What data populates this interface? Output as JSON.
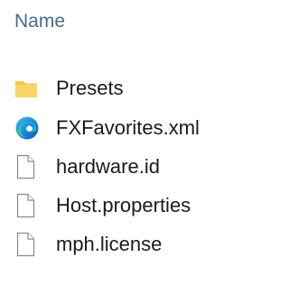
{
  "file_list": {
    "column_header": "Name",
    "items": [
      {
        "label": "Presets",
        "icon": "folder-icon",
        "color": "#f4c542"
      },
      {
        "label": "FXFavorites.xml",
        "icon": "edge-browser-icon",
        "color": "#1f78d1"
      },
      {
        "label": "hardware.id",
        "icon": "generic-file-icon"
      },
      {
        "label": "Host.properties",
        "icon": "generic-file-icon"
      },
      {
        "label": "mph.license",
        "icon": "generic-file-icon"
      }
    ]
  }
}
